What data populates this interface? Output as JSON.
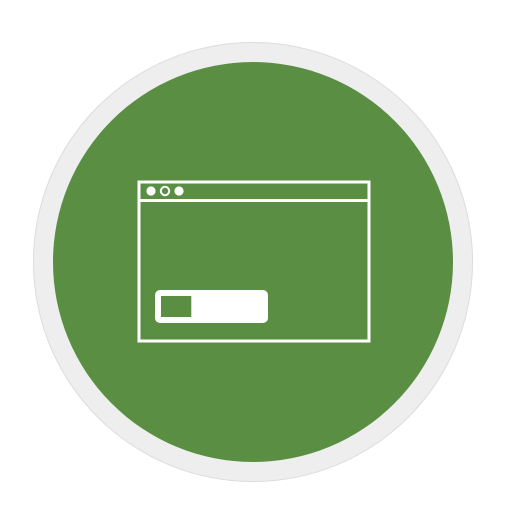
{
  "badge": {
    "ring_color": "#eeeeee",
    "fill_color": "#5a8f43",
    "icon_color": "#ffffff",
    "icon": "browser-window-with-progress-bar-icon"
  },
  "window": {
    "title_bar_dots": [
      "filled",
      "hollow",
      "filled"
    ]
  },
  "progress": {
    "fraction": 0.3
  }
}
